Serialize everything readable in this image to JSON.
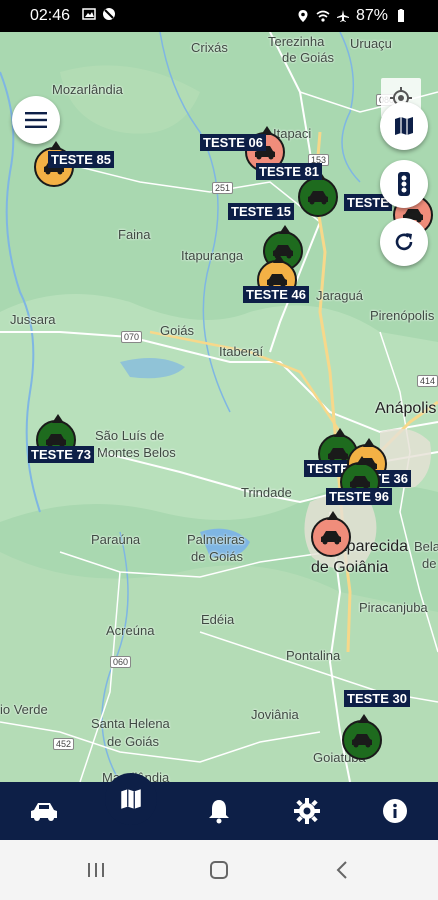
{
  "status_bar": {
    "time": "02:46",
    "battery": "87%",
    "left_icons": [
      "image-icon",
      "no-sync-icon"
    ],
    "right_icons": [
      "location-icon",
      "wifi-icon",
      "airplane-icon",
      "battery-icon"
    ]
  },
  "map": {
    "places": [
      {
        "name": "Crixás",
        "big": false
      },
      {
        "name": "Terezinha",
        "big": false
      },
      {
        "name": "de Goiás",
        "big": false
      },
      {
        "name": "Uruaçu",
        "big": false
      },
      {
        "name": "Mozarlândia",
        "big": false
      },
      {
        "name": "Itapaci",
        "big": false
      },
      {
        "name": "Faina",
        "big": false
      },
      {
        "name": "Itapuranga",
        "big": false
      },
      {
        "name": "Jussara",
        "big": false
      },
      {
        "name": "Goiás",
        "big": false
      },
      {
        "name": "Jaraguá",
        "big": false
      },
      {
        "name": "Pirenópolis",
        "big": false
      },
      {
        "name": "Itaberaí",
        "big": false
      },
      {
        "name": "Anápolis",
        "big": true
      },
      {
        "name": "São Luís de",
        "big": false
      },
      {
        "name": "Montes Belos",
        "big": false
      },
      {
        "name": "Trindade",
        "big": false
      },
      {
        "name": "Paraúna",
        "big": false
      },
      {
        "name": "Palmeiras",
        "big": false
      },
      {
        "name": "de Goiás",
        "big": false
      },
      {
        "name": "Aparecida",
        "big": true
      },
      {
        "name": "de Goiânia",
        "big": true
      },
      {
        "name": "Bela",
        "big": false
      },
      {
        "name": "de",
        "big": false
      },
      {
        "name": "Acreúna",
        "big": false
      },
      {
        "name": "Edéia",
        "big": false
      },
      {
        "name": "Piracanjuba",
        "big": false
      },
      {
        "name": "Pontalina",
        "big": false
      },
      {
        "name": "io Verde",
        "big": false
      },
      {
        "name": "Santa Helena",
        "big": false
      },
      {
        "name": "de Goiás",
        "big": false
      },
      {
        "name": "Joviânia",
        "big": false
      },
      {
        "name": "Goiatuba",
        "big": false
      },
      {
        "name": "Maurilândia",
        "big": false
      }
    ],
    "road_shields": [
      "080",
      "251",
      "153",
      "070",
      "414",
      "060",
      "452"
    ],
    "vehicles": [
      {
        "label": "TESTE 85",
        "status": "orange"
      },
      {
        "label": "TESTE 06",
        "status": "red"
      },
      {
        "label": "TESTE 81",
        "status": "green"
      },
      {
        "label": "TESTE 15",
        "status": "green"
      },
      {
        "label": "TESTE",
        "status": "red"
      },
      {
        "label": "TESTE 46",
        "status": "orange"
      },
      {
        "label": "TESTE 73",
        "status": "green"
      },
      {
        "label": "TESTE",
        "status": "green"
      },
      {
        "label": "TESTE 36",
        "status": "orange"
      },
      {
        "label": "TESTE 96",
        "status": "green"
      },
      {
        "label": "TESTE 30",
        "status": "green"
      }
    ]
  },
  "controls": {
    "menu_icon": "menu-icon",
    "locate_icon": "my-location-icon",
    "map_icon": "map-icon",
    "traffic_icon": "traffic-light-icon",
    "refresh_icon": "refresh-icon"
  },
  "bottom_nav": {
    "items": [
      "car-icon",
      "map-icon",
      "bell-icon",
      "gear-icon",
      "info-icon"
    ],
    "active": "map-icon"
  },
  "colors": {
    "navy": "#0d1f47",
    "vehicle_green": "#1e6b1e",
    "vehicle_orange": "#f3b145",
    "vehicle_red": "#f08d7b",
    "map_bg": "#a9d8b0"
  }
}
